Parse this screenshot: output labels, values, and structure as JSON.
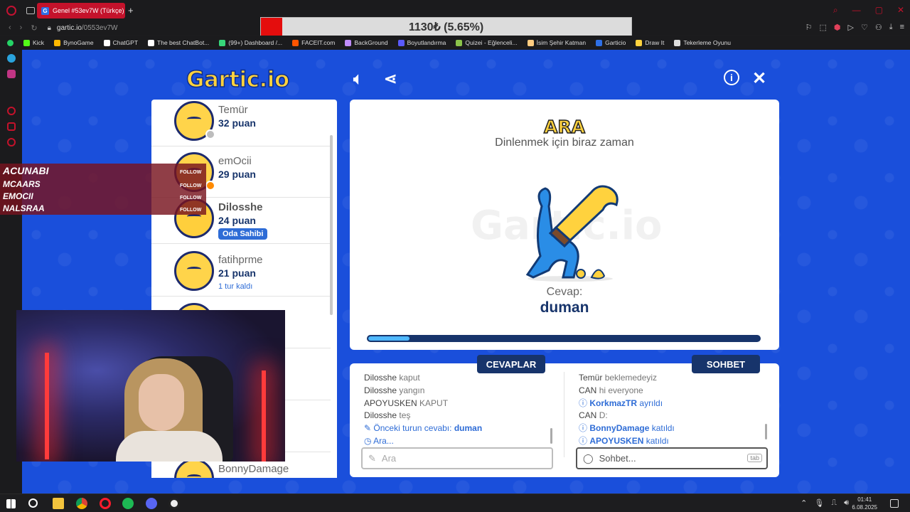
{
  "browser": {
    "tab_title": "Genel #53ev7W (Türkçe)",
    "tab_favicon": "G",
    "url_domain": "gartic.io",
    "url_path": "/0553ev7W",
    "bookmarks": [
      "Kick",
      "BynoGame",
      "ChatGPT",
      "The best ChatBot...",
      "(99+) Dashboard /...",
      "FACEIT.com",
      "BackGround",
      "Boyutlandırma",
      "Quizei - Eğlenceli...",
      "İsim Şehir Katman",
      "Garticio",
      "Draw It",
      "Tekerleme Oyunu"
    ]
  },
  "price_overlay": {
    "text": "1130₺ (5.65%)",
    "color": "#e40d0d"
  },
  "game": {
    "logo": "Gartic.io",
    "players": [
      {
        "name": "Temür",
        "score": "32 puan"
      },
      {
        "name": "emOcii",
        "score": "29 puan"
      },
      {
        "name": "Dilosshe",
        "score": "24 puan",
        "badge": "Oda Sahibi"
      },
      {
        "name": "fatihprme",
        "score": "21 puan",
        "note": "1 tur kaldı"
      },
      {
        "name": "BonnyDamage"
      }
    ],
    "round": {
      "title": "ARA",
      "subtitle": "Dinlenmek için biraz zaman",
      "watermark": "Gartic.io",
      "answer_label": "Cevap:",
      "answer": "duman",
      "progress": 0.105
    },
    "answers": {
      "tab_label": "CEVAPLAR",
      "lines": [
        {
          "user": "Dilosshe",
          "text": "kaput"
        },
        {
          "user": "Dilosshe",
          "text": "yangın"
        },
        {
          "user": "APOYUSKEN",
          "text": "KAPUT"
        },
        {
          "user": "Dilosshe",
          "text": "teş"
        }
      ],
      "prev_answer_label": "Önceki turun cevabı:",
      "prev_answer": "duman",
      "status": "Ara...",
      "input_placeholder": "Ara"
    },
    "chat": {
      "tab_label": "SOHBET",
      "lines": [
        {
          "user": "Temür",
          "text": "beklemedeyiz"
        },
        {
          "user": "CAN",
          "text": "hi everyone"
        },
        {
          "user": "KorkmazTR",
          "text": "ayrıldı",
          "system": true
        },
        {
          "user": "CAN",
          "text": "D:"
        },
        {
          "user": "BonnyDamage",
          "text": "katıldı",
          "system": true
        },
        {
          "user": "APOYUSKEN",
          "text": "katıldı",
          "system": true
        }
      ],
      "input_placeholder": "Sohbet...",
      "tab_hint": "tab"
    }
  },
  "stream_follows": {
    "tag": "FOLLOW",
    "names": [
      "ACUNABI",
      "MCAARS",
      "EMOCII",
      "NALSRAA"
    ]
  },
  "taskbar": {
    "time": "01:41",
    "date": "6.08.2025"
  },
  "colors": {
    "game_bg": "#1a4fdb",
    "navy": "#17346b",
    "accent": "#2e6cd6",
    "logo_yellow": "#ffd23e"
  }
}
